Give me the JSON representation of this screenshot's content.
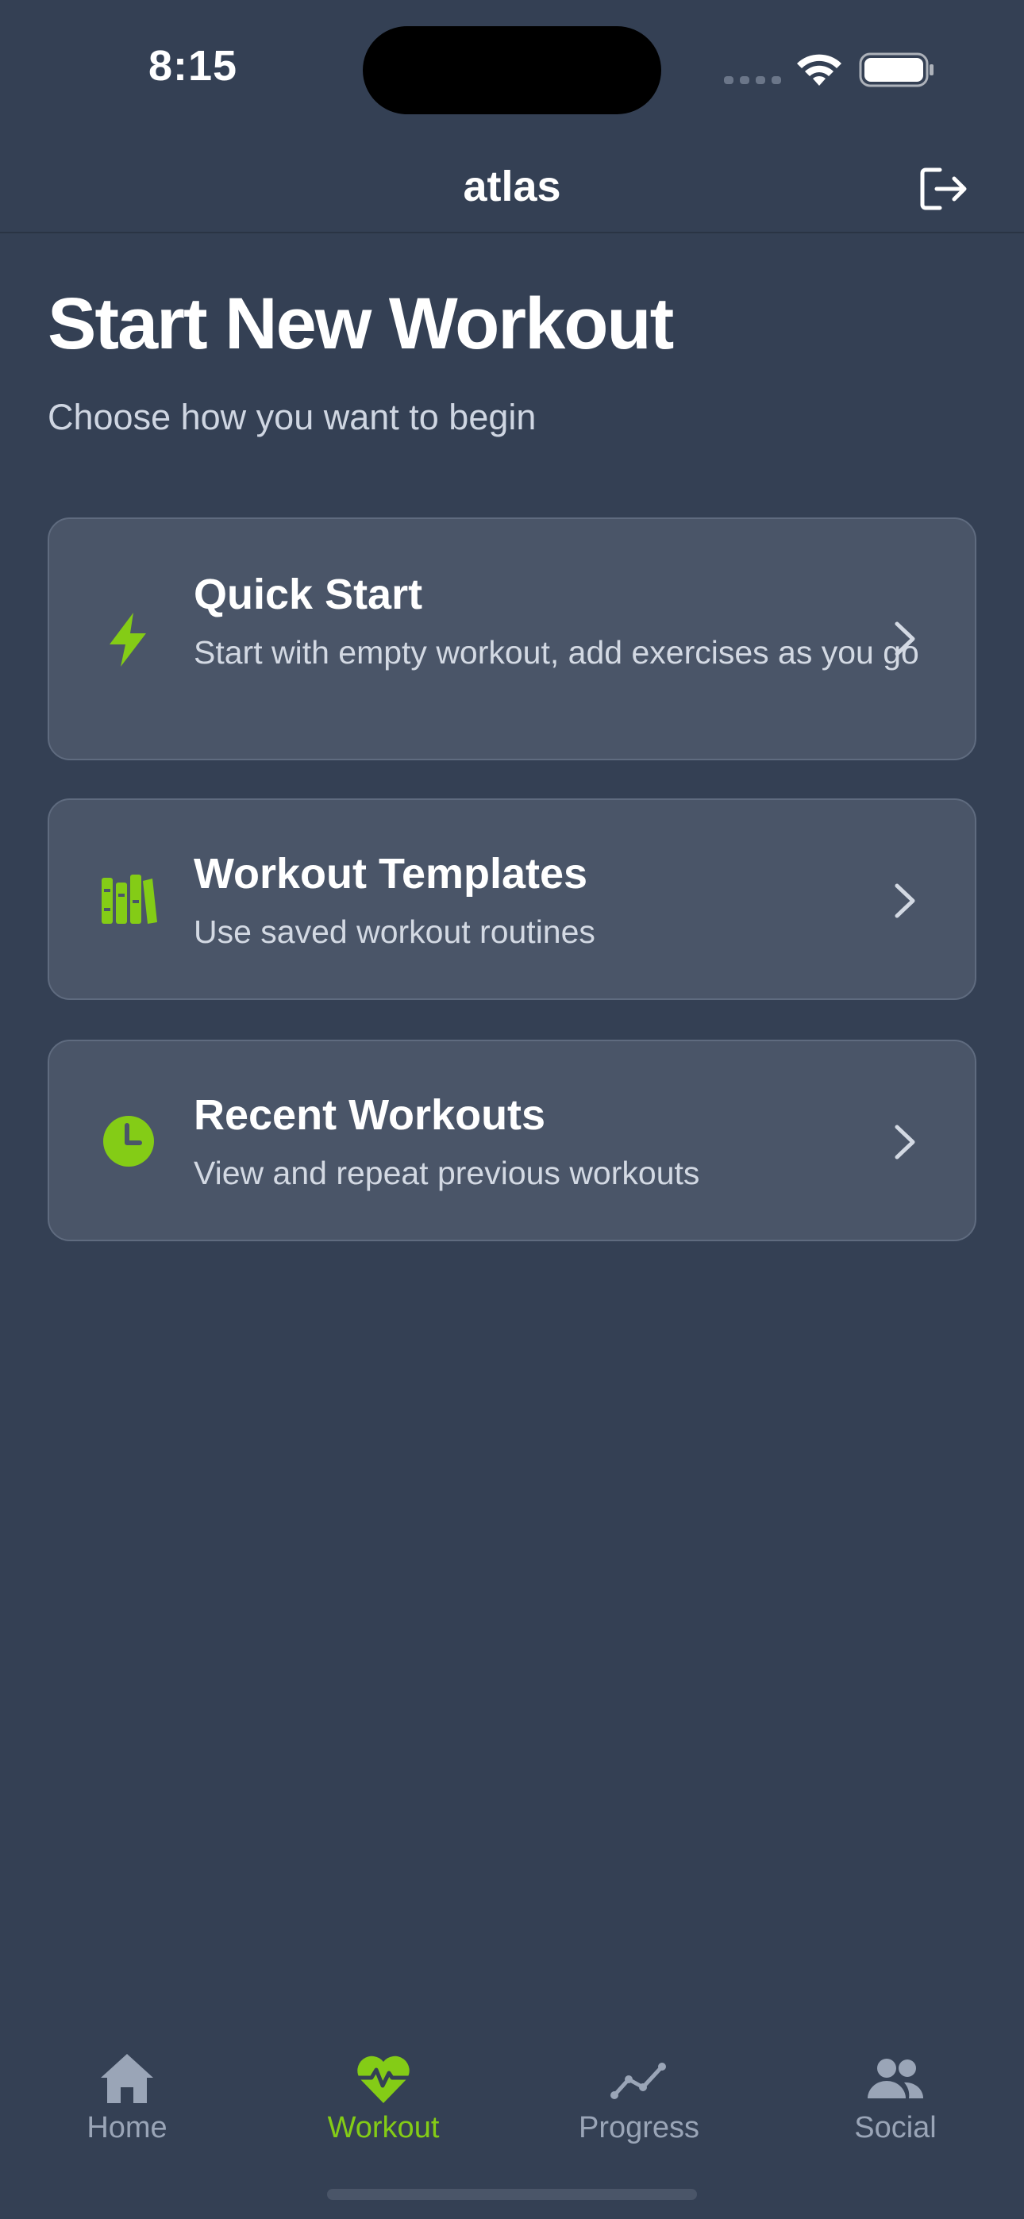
{
  "status_bar": {
    "time": "8:15"
  },
  "header": {
    "title": "atlas",
    "logout_icon": "logout-icon"
  },
  "page": {
    "title": "Start New Workout",
    "subtitle": "Choose how you want to begin"
  },
  "options": [
    {
      "title": "Quick Start",
      "description": "Start with empty workout, add exercises as you go",
      "icon": "bolt-icon"
    },
    {
      "title": "Workout Templates",
      "description": "Use saved workout routines",
      "icon": "templates-icon"
    },
    {
      "title": "Recent Workouts",
      "description": "View and repeat previous workouts",
      "icon": "clock-icon"
    }
  ],
  "tabs": [
    {
      "label": "Home",
      "icon": "home-icon",
      "active": false
    },
    {
      "label": "Workout",
      "icon": "heart-pulse-icon",
      "active": true
    },
    {
      "label": "Progress",
      "icon": "trend-line-icon",
      "active": false
    },
    {
      "label": "Social",
      "icon": "users-icon",
      "active": false
    }
  ],
  "colors": {
    "background": "#344054",
    "card": "#4a5568",
    "accent": "#84cc16",
    "tab_inactive": "#9aa5b7"
  }
}
